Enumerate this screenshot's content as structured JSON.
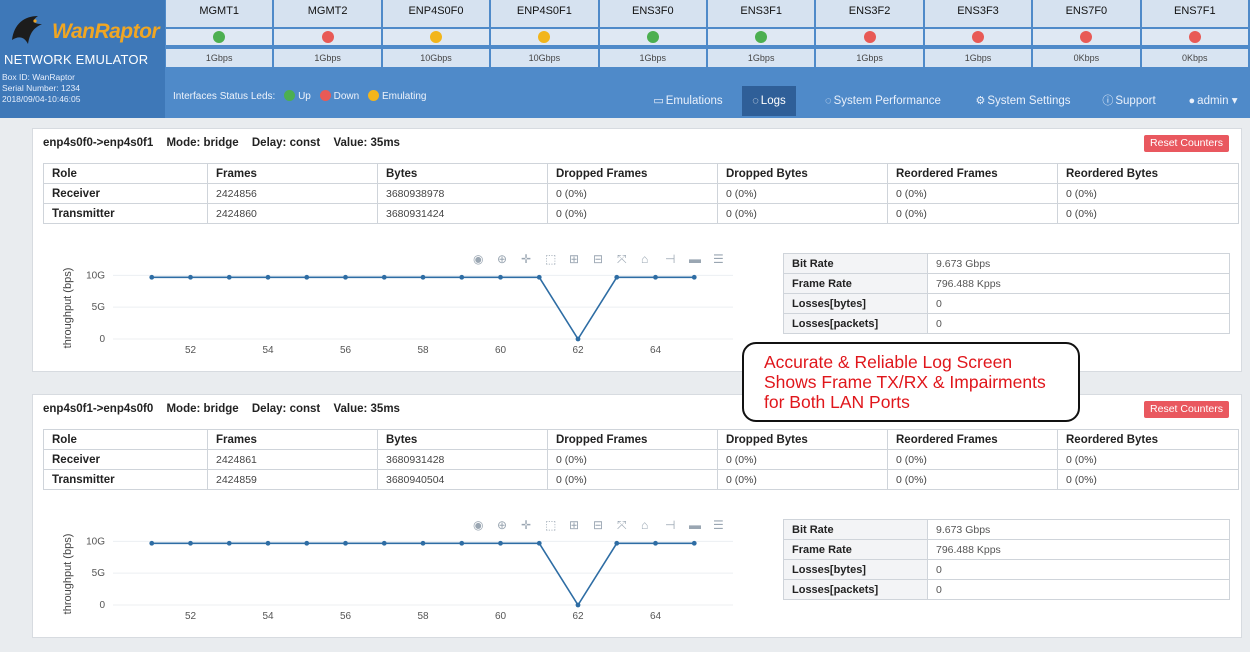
{
  "brand": {
    "name": "WanRaptor",
    "subtitle": "NETWORK EMULATOR",
    "box_id": "Box ID: WanRaptor",
    "serial": "Serial Number: 1234",
    "datetime": "2018/09/04-10:46:05"
  },
  "interfaces": [
    {
      "name": "MGMT1",
      "speed": "1Gbps",
      "status": "up"
    },
    {
      "name": "MGMT2",
      "speed": "1Gbps",
      "status": "down"
    },
    {
      "name": "ENP4S0F0",
      "speed": "10Gbps",
      "status": "emulating"
    },
    {
      "name": "ENP4S0F1",
      "speed": "10Gbps",
      "status": "emulating"
    },
    {
      "name": "ENS3F0",
      "speed": "1Gbps",
      "status": "up"
    },
    {
      "name": "ENS3F1",
      "speed": "1Gbps",
      "status": "up"
    },
    {
      "name": "ENS3F2",
      "speed": "1Gbps",
      "status": "down"
    },
    {
      "name": "ENS3F3",
      "speed": "1Gbps",
      "status": "down"
    },
    {
      "name": "ENS7F0",
      "speed": "0Kbps",
      "status": "down"
    },
    {
      "name": "ENS7F1",
      "speed": "0Kbps",
      "status": "down"
    }
  ],
  "status_colors": {
    "up": "#4caf50",
    "down": "#e85a56",
    "emulating": "#f2b51b"
  },
  "legend": {
    "label": "Interfaces Status Leds:",
    "up": "Up",
    "down": "Down",
    "emulating": "Emulating"
  },
  "nav": {
    "emulations": "Emulations",
    "logs": "Logs",
    "system_performance": "System Performance",
    "system_settings": "System Settings",
    "support": "Support",
    "user": "admin"
  },
  "table_headers": [
    "Role",
    "Frames",
    "Bytes",
    "Dropped Frames",
    "Dropped Bytes",
    "Reordered Frames",
    "Reordered Bytes"
  ],
  "panels": [
    {
      "path": "enp4s0f0->enp4s0f1",
      "mode": "Mode: bridge",
      "delay": "Delay: const",
      "value": "Value: 35ms",
      "reset_label": "Reset Counters",
      "rows": [
        [
          "Receiver",
          "2424856",
          "3680938978",
          "0 (0%)",
          "0 (0%)",
          "0 (0%)",
          "0 (0%)"
        ],
        [
          "Transmitter",
          "2424860",
          "3680931424",
          "0 (0%)",
          "0 (0%)",
          "0 (0%)",
          "0 (0%)"
        ]
      ],
      "metrics": [
        {
          "label": "Bit Rate",
          "value": "9.673 Gbps"
        },
        {
          "label": "Frame Rate",
          "value": "796.488 Kpps"
        },
        {
          "label": "Losses[bytes]",
          "value": "0"
        },
        {
          "label": "Losses[packets]",
          "value": "0"
        }
      ]
    },
    {
      "path": "enp4s0f1->enp4s0f0",
      "mode": "Mode: bridge",
      "delay": "Delay: const",
      "value": "Value: 35ms",
      "reset_label": "Reset Counters",
      "rows": [
        [
          "Receiver",
          "2424861",
          "3680931428",
          "0 (0%)",
          "0 (0%)",
          "0 (0%)",
          "0 (0%)"
        ],
        [
          "Transmitter",
          "2424859",
          "3680940504",
          "0 (0%)",
          "0 (0%)",
          "0 (0%)",
          "0 (0%)"
        ]
      ],
      "metrics": [
        {
          "label": "Bit Rate",
          "value": "9.673 Gbps"
        },
        {
          "label": "Frame Rate",
          "value": "796.488 Kpps"
        },
        {
          "label": "Losses[bytes]",
          "value": "0"
        },
        {
          "label": "Losses[packets]",
          "value": "0"
        }
      ]
    }
  ],
  "chart_data": [
    {
      "type": "line",
      "ylabel": "throughput (bps)",
      "x": [
        51,
        52,
        53,
        54,
        55,
        56,
        57,
        58,
        59,
        60,
        61,
        62,
        63,
        64,
        65
      ],
      "y": [
        9.7,
        9.7,
        9.7,
        9.7,
        9.7,
        9.7,
        9.7,
        9.7,
        9.7,
        9.7,
        9.7,
        0,
        9.7,
        9.7,
        9.7
      ],
      "x_ticks": [
        52,
        54,
        56,
        58,
        60,
        62,
        64
      ],
      "y_ticks": [
        {
          "v": 0,
          "label": "0"
        },
        {
          "v": 5,
          "label": "5G"
        },
        {
          "v": 10,
          "label": "10G"
        }
      ],
      "xlim": [
        50,
        66
      ],
      "ylim": [
        0,
        11
      ],
      "color": "#2e6da4"
    },
    {
      "type": "line",
      "ylabel": "throughput (bps)",
      "x": [
        51,
        52,
        53,
        54,
        55,
        56,
        57,
        58,
        59,
        60,
        61,
        62,
        63,
        64,
        65
      ],
      "y": [
        9.7,
        9.7,
        9.7,
        9.7,
        9.7,
        9.7,
        9.7,
        9.7,
        9.7,
        9.7,
        9.7,
        0,
        9.7,
        9.7,
        9.7
      ],
      "x_ticks": [
        52,
        54,
        56,
        58,
        60,
        62,
        64
      ],
      "y_ticks": [
        {
          "v": 0,
          "label": "0"
        },
        {
          "v": 5,
          "label": "5G"
        },
        {
          "v": 10,
          "label": "10G"
        }
      ],
      "xlim": [
        50,
        66
      ],
      "ylim": [
        0,
        11
      ],
      "color": "#2e6da4"
    }
  ],
  "callout": {
    "line1": "Accurate & Reliable Log Screen",
    "line2": "Shows Frame TX/RX & Impairments",
    "line3": "for Both LAN Ports"
  }
}
